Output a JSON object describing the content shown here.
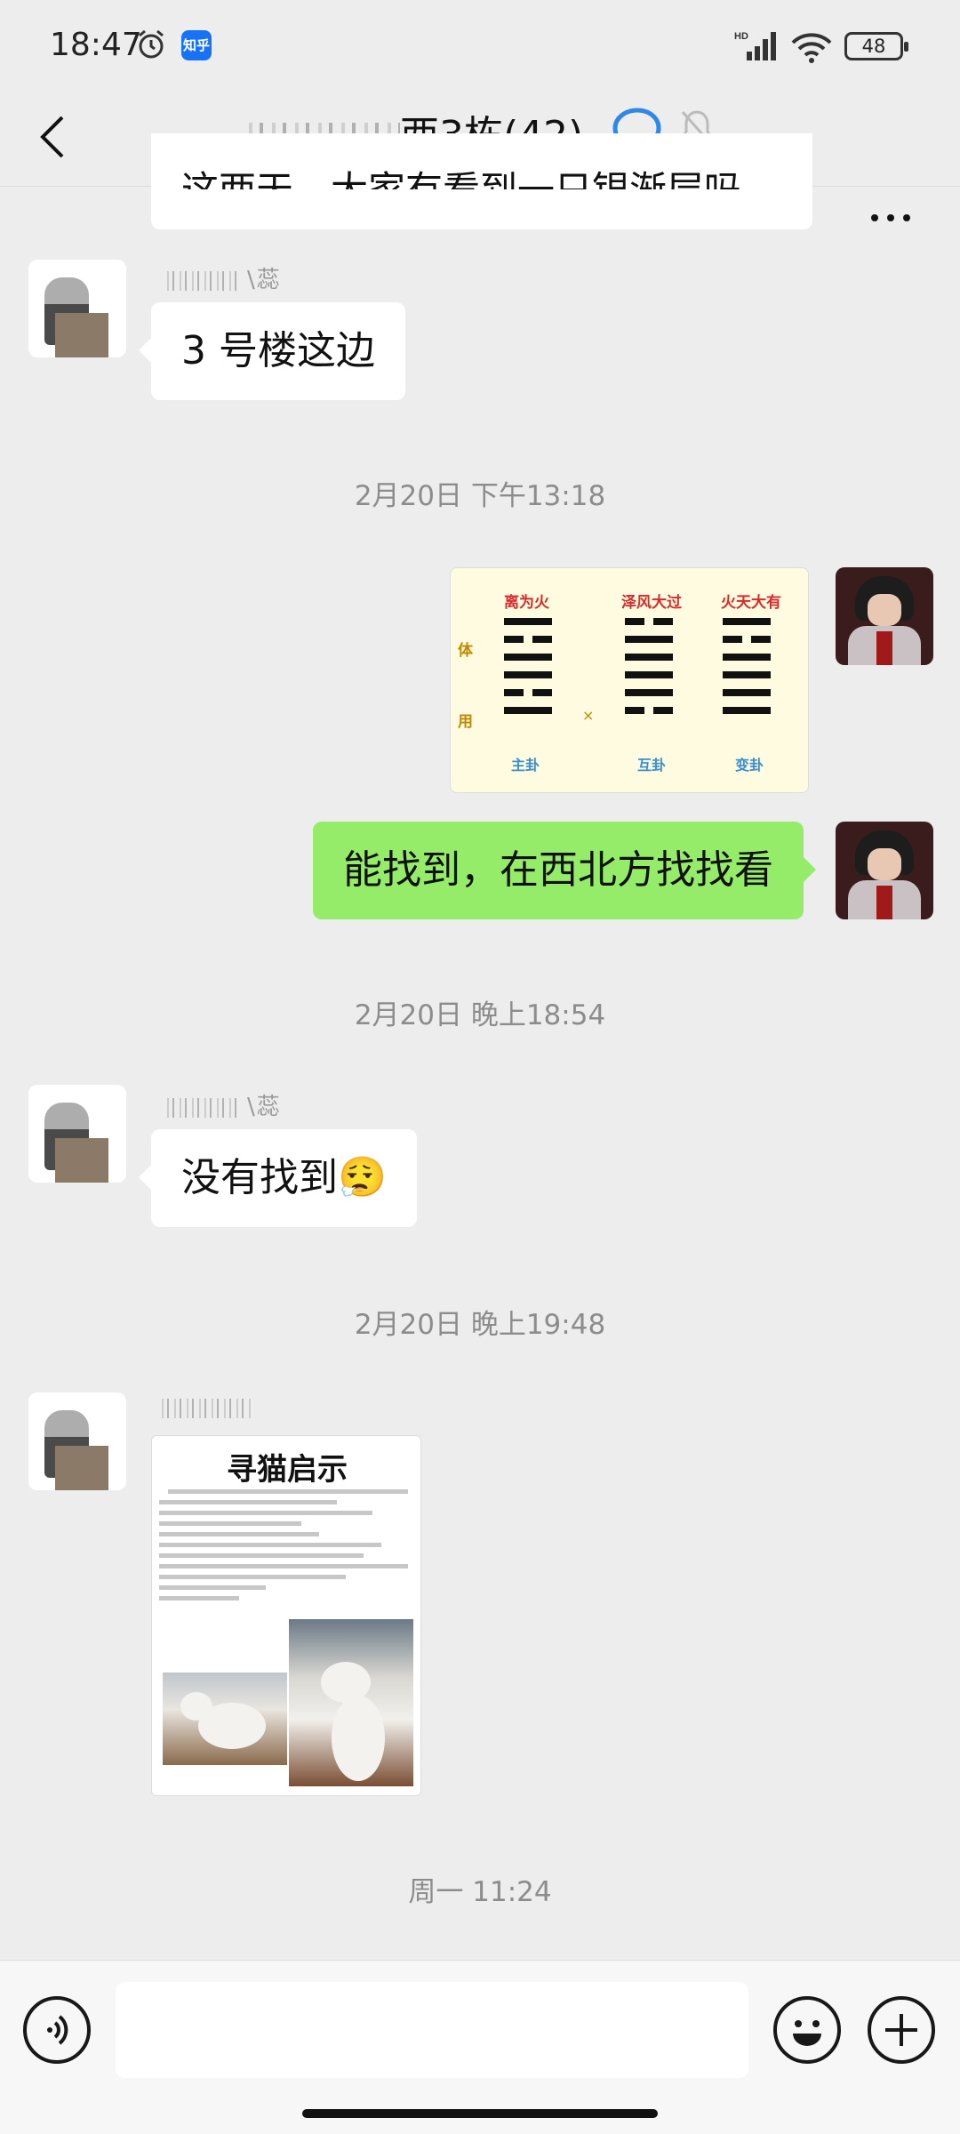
{
  "status_bar": {
    "time": "18:47",
    "app_badge": "知乎",
    "network": "HD",
    "battery": "48"
  },
  "header": {
    "title": "西3栋(42)",
    "back_icon": "chevron-left-icon",
    "more_icon": "more-icon"
  },
  "messages": {
    "partial_text": "这两天，大家有看到一只银渐层吗",
    "m1": {
      "nickname": "\\蕊",
      "text": "3 号楼这边"
    },
    "ts1": "2月20日 下午13:18",
    "hexagram": {
      "top_labels": [
        "离为火",
        "泽风大过",
        "火天大有"
      ],
      "side_labels": [
        "体",
        "用"
      ],
      "bottom_labels": [
        "主卦",
        "互卦",
        "变卦"
      ],
      "cross": "×"
    },
    "m2": {
      "text": "能找到，在西北方找找看"
    },
    "ts2": "2月20日 晚上18:54",
    "m3": {
      "nickname": "\\蕊",
      "text": "没有找到",
      "emoji": "😮‍💨"
    },
    "ts3": "2月20日 晚上19:48",
    "m4": {
      "poster_title": "寻猫启示"
    },
    "ts4": "周一 11:24"
  },
  "input": {
    "value": "",
    "placeholder": ""
  }
}
